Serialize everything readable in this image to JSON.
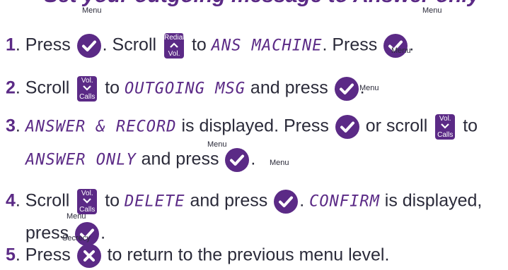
{
  "heading": "Set your outgoing message to Answer only",
  "icons": {
    "menu_label": "Menu",
    "secrecy_label": "Secrecy",
    "redial_label": "Redial",
    "redial_sub": "Vol.",
    "vol_label": "Vol.",
    "calls_label": "Calls",
    "menu_icon": "check-icon",
    "secrecy_icon": "cross-icon",
    "redial_icon": "chevron-up-icon",
    "vol_icon": "chevron-down-icon",
    "accent_color": "#5b2a86"
  },
  "steps": [
    {
      "num": "1",
      "t1": ". Press",
      "t2": ". Scroll",
      "d1": "ANS MACHINE",
      "t3": ". Press",
      "t4": "."
    },
    {
      "num": "2",
      "t1": ". Scroll",
      "t2": " to",
      "d1": "OUTGOING MSG",
      "t3": " and press",
      "t4": "."
    },
    {
      "num": "3",
      "t1": ". ",
      "d1": "ANSWER & RECORD",
      "t2": " is displayed. Press",
      "t3": " or scroll",
      "t4": " to",
      "d2": "ANSWER ONLY",
      "t5": " and press",
      "t6": "."
    },
    {
      "num": "4",
      "t1": ". Scroll",
      "t2": " to",
      "d1": "DELETE",
      "t3": " and press",
      "t4": ".",
      "d2": "CONFIRM",
      "t5": " is displayed,",
      "t6": "press",
      "t7": "."
    },
    {
      "num": "5",
      "t1": ". Press",
      "t2": " to return to the previous menu level."
    }
  ]
}
